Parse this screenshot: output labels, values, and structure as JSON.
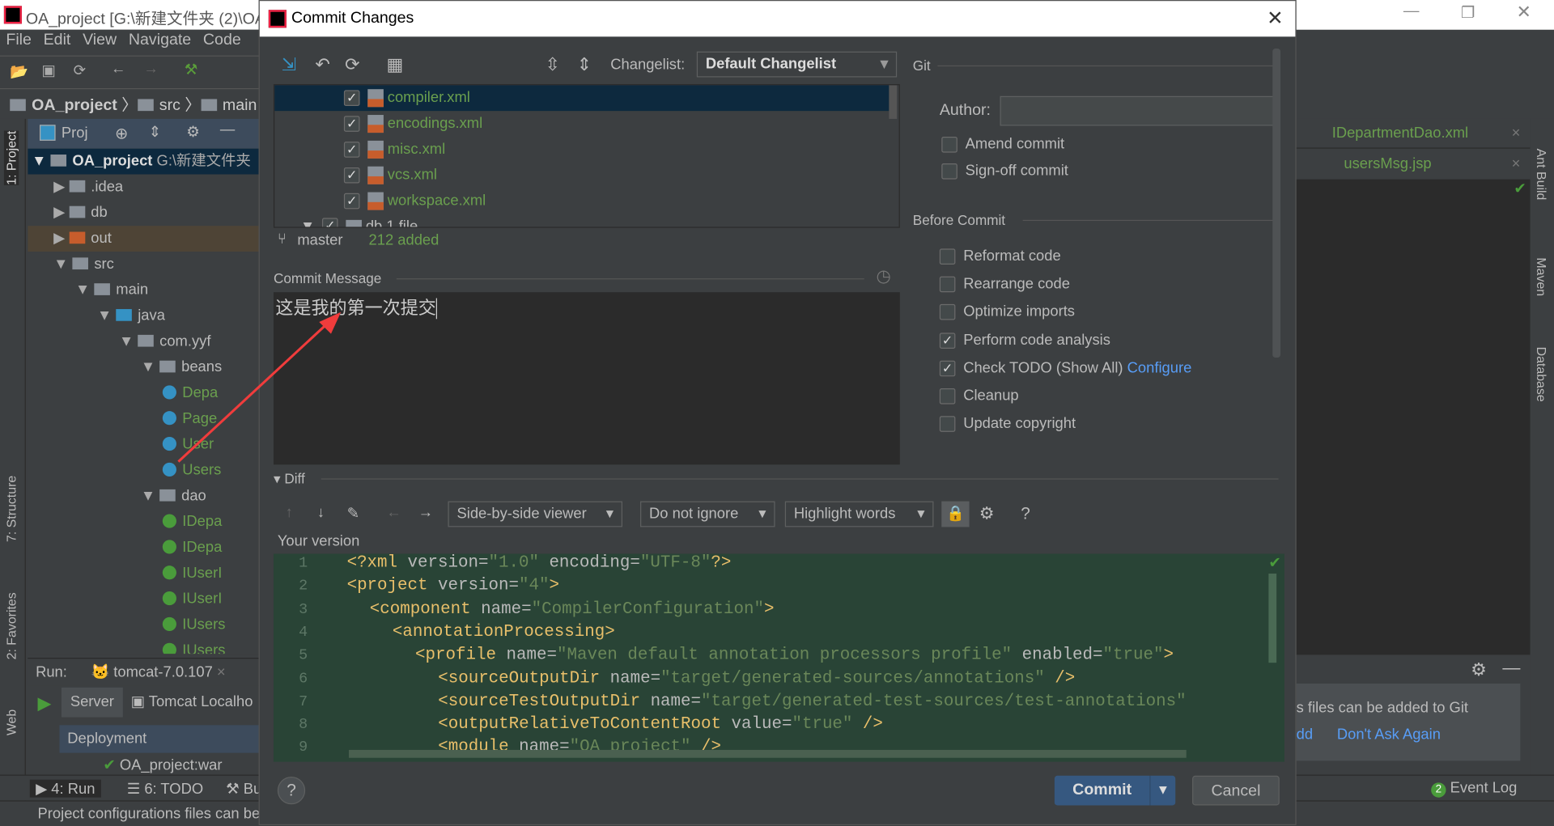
{
  "ide": {
    "title": "OA_project [G:\\新建文件夹 (2)\\OA",
    "menu": [
      "File",
      "Edit",
      "View",
      "Navigate",
      "Code"
    ],
    "breadcrumb": [
      "OA_project",
      "src",
      "main"
    ],
    "project_panel": {
      "label": "Proj",
      "root": "OA_project",
      "root_path": "G:\\新建文件夹",
      "tree": [
        {
          "name": ".idea",
          "depth": 1
        },
        {
          "name": "db",
          "depth": 1
        },
        {
          "name": "out",
          "depth": 1
        },
        {
          "name": "src",
          "depth": 1
        },
        {
          "name": "main",
          "depth": 2
        },
        {
          "name": "java",
          "depth": 3
        },
        {
          "name": "com.yyf",
          "depth": 4
        },
        {
          "name": "beans",
          "depth": 5
        },
        {
          "name": "Depa",
          "depth": 6
        },
        {
          "name": "Page",
          "depth": 6
        },
        {
          "name": "User",
          "depth": 6
        },
        {
          "name": "Users",
          "depth": 6
        },
        {
          "name": "dao",
          "depth": 5
        },
        {
          "name": "IDepa",
          "depth": 6
        },
        {
          "name": "IDepa",
          "depth": 6
        },
        {
          "name": "IUserI",
          "depth": 6
        },
        {
          "name": "IUserI",
          "depth": 6
        },
        {
          "name": "IUsers",
          "depth": 6
        },
        {
          "name": "IUsers",
          "depth": 6
        }
      ]
    },
    "left_tabs": [
      "1: Project",
      "7: Structure",
      "2: Favorites",
      "Web"
    ],
    "right_tabs": [
      "Ant Build",
      "Maven",
      "Database"
    ],
    "editor_tabs": [
      "IDepartmentDao.xml",
      "usersMsg.jsp"
    ],
    "run": {
      "label": "Run:",
      "config": "tomcat-7.0.107",
      "tabs": [
        "Server",
        "Tomcat Localho"
      ],
      "deployment": "Deployment",
      "artifact": "OA_project:war"
    },
    "bottom_tabs": [
      "4: Run",
      "6: TODO",
      "Bu"
    ],
    "event_log": "Event Log",
    "event_count": "2",
    "notification": {
      "text": "s files can be added to Git",
      "link1": "dd",
      "link2": "Don't Ask Again"
    },
    "status": "Project configurations files can be added to Git"
  },
  "dialog": {
    "title": "Commit Changes",
    "changelist_label": "Changelist:",
    "changelist": "Default Changelist",
    "files": [
      "compiler.xml",
      "encodings.xml",
      "misc.xml",
      "vcs.xml",
      "workspace.xml"
    ],
    "partial_row": "db 1 file",
    "branch": "master",
    "added": "212 added",
    "commit_message_label": "Commit Message",
    "commit_message": "这是我的第一次提交",
    "git_label": "Git",
    "author_label": "Author:",
    "author_value": "",
    "git_options": [
      {
        "label": "Amend commit",
        "checked": false
      },
      {
        "label": "Sign-off commit",
        "checked": false
      }
    ],
    "before_commit_label": "Before Commit",
    "before_options": [
      {
        "label": "Reformat code",
        "checked": false
      },
      {
        "label": "Rearrange code",
        "checked": false
      },
      {
        "label": "Optimize imports",
        "checked": false
      },
      {
        "label": "Perform code analysis",
        "checked": true
      },
      {
        "label": "Check TODO (Show All)",
        "checked": true
      },
      {
        "label": "Cleanup",
        "checked": false
      },
      {
        "label": "Update copyright",
        "checked": false
      }
    ],
    "configure": "Configure",
    "diff_label": "Diff",
    "viewer": "Side-by-side viewer",
    "ignore": "Do not ignore",
    "highlight": "Highlight words",
    "your_version": "Your version",
    "code": [
      {
        "n": "1",
        "indent": 0,
        "t": "<?xml",
        "a": " version=",
        "v": "\"1.0\"",
        "a2": " encoding=",
        "v2": "\"UTF-8\"",
        "e": "?>"
      },
      {
        "n": "2",
        "indent": 0,
        "t": "<project",
        "a": " version=",
        "v": "\"4\"",
        "e": ">"
      },
      {
        "n": "3",
        "indent": 1,
        "t": "<component",
        "a": " name=",
        "v": "\"CompilerConfiguration\"",
        "e": ">"
      },
      {
        "n": "4",
        "indent": 2,
        "t": "<annotationProcessing>"
      },
      {
        "n": "5",
        "indent": 3,
        "t": "<profile",
        "a": " name=",
        "v": "\"Maven default annotation processors profile\"",
        "a2": " enabled=",
        "v2": "\"true\"",
        "e": ">"
      },
      {
        "n": "6",
        "indent": 4,
        "t": "<sourceOutputDir",
        "a": " name=",
        "v": "\"target/generated-sources/annotations\"",
        "e": " />"
      },
      {
        "n": "7",
        "indent": 4,
        "t": "<sourceTestOutputDir",
        "a": " name=",
        "v": "\"target/generated-test-sources/test-annotations\""
      },
      {
        "n": "8",
        "indent": 4,
        "t": "<outputRelativeToContentRoot",
        "a": " value=",
        "v": "\"true\"",
        "e": " />"
      },
      {
        "n": "9",
        "indent": 4,
        "t": "<module",
        "a": " name=",
        "v": "\"OA_project\"",
        "e": " />"
      }
    ],
    "commit_button": "Commit",
    "cancel_button": "Cancel",
    "help": "?"
  },
  "colors": {
    "accent": "#365880",
    "green_file": "#6a9f4e",
    "link": "#589df6",
    "code_bg": "#294436"
  }
}
